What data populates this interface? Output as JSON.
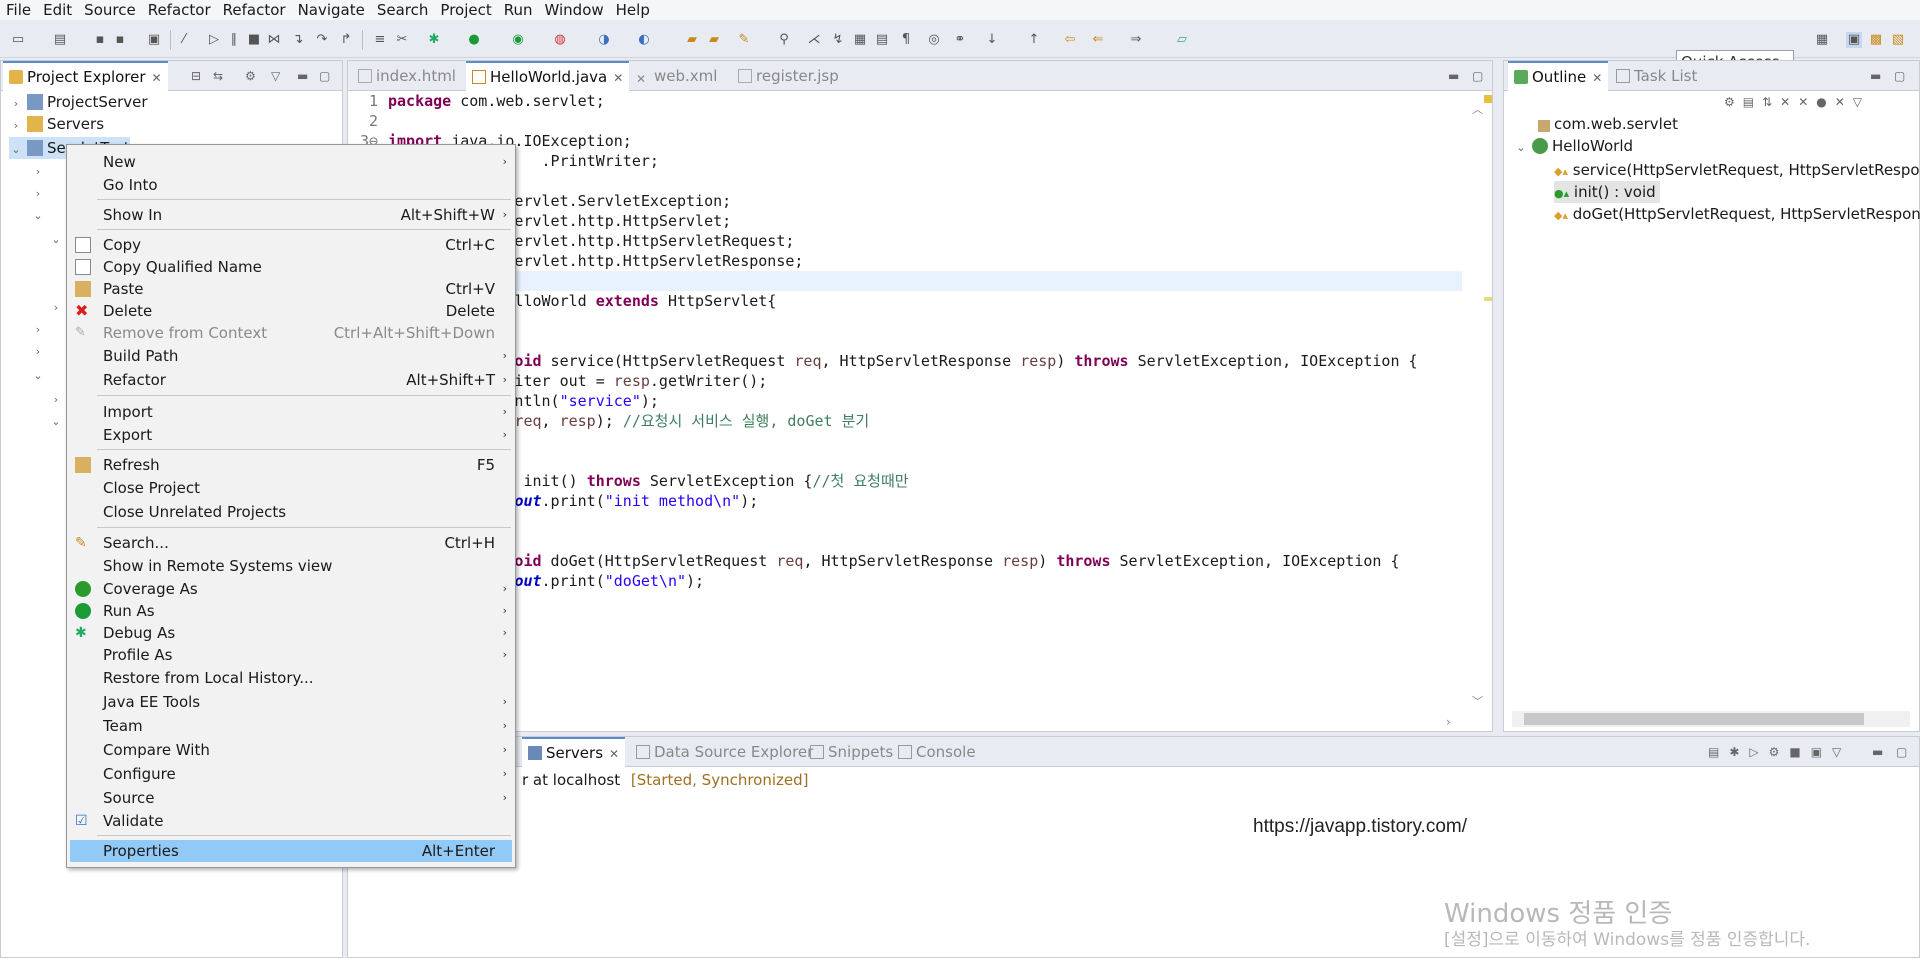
{
  "menubar": [
    "File",
    "Edit",
    "Source",
    "Refactor",
    "Refactor",
    "Navigate",
    "Search",
    "Project",
    "Run",
    "Window",
    "Help"
  ],
  "quick_access": "Quick Access",
  "project_explorer": {
    "tab_label": "Project Explorer",
    "items": [
      "ProjectServer",
      "Servers",
      "ServletTest"
    ]
  },
  "editor": {
    "tabs": [
      "index.html",
      "HelloWorld.java",
      "web.xml",
      "register.jsp"
    ],
    "active_tab": "HelloWorld.java"
  },
  "context_menu": {
    "items": [
      {
        "label": "New",
        "shortcut": "",
        "submenu": true
      },
      {
        "label": "Go Into",
        "shortcut": "",
        "submenu": false
      },
      {
        "label": "Show In",
        "shortcut": "Alt+Shift+W",
        "submenu": true
      },
      {
        "label": "Copy",
        "shortcut": "Ctrl+C",
        "submenu": false
      },
      {
        "label": "Copy Qualified Name",
        "shortcut": "",
        "submenu": false
      },
      {
        "label": "Paste",
        "shortcut": "Ctrl+V",
        "submenu": false
      },
      {
        "label": "Delete",
        "shortcut": "Delete",
        "submenu": false
      },
      {
        "label": "Remove from Context",
        "shortcut": "Ctrl+Alt+Shift+Down",
        "submenu": false
      },
      {
        "label": "Build Path",
        "shortcut": "",
        "submenu": true
      },
      {
        "label": "Refactor",
        "shortcut": "Alt+Shift+T",
        "submenu": true
      },
      {
        "label": "Import",
        "shortcut": "",
        "submenu": true
      },
      {
        "label": "Export",
        "shortcut": "",
        "submenu": true
      },
      {
        "label": "Refresh",
        "shortcut": "F5",
        "submenu": false
      },
      {
        "label": "Close Project",
        "shortcut": "",
        "submenu": false
      },
      {
        "label": "Close Unrelated Projects",
        "shortcut": "",
        "submenu": false
      },
      {
        "label": "Search...",
        "shortcut": "Ctrl+H",
        "submenu": false
      },
      {
        "label": "Show in Remote Systems view",
        "shortcut": "",
        "submenu": false
      },
      {
        "label": "Coverage As",
        "shortcut": "",
        "submenu": true
      },
      {
        "label": "Run As",
        "shortcut": "",
        "submenu": true
      },
      {
        "label": "Debug As",
        "shortcut": "",
        "submenu": true
      },
      {
        "label": "Profile As",
        "shortcut": "",
        "submenu": true
      },
      {
        "label": "Restore from Local History...",
        "shortcut": "",
        "submenu": false
      },
      {
        "label": "Java EE Tools",
        "shortcut": "",
        "submenu": true
      },
      {
        "label": "Team",
        "shortcut": "",
        "submenu": true
      },
      {
        "label": "Compare With",
        "shortcut": "",
        "submenu": true
      },
      {
        "label": "Configure",
        "shortcut": "",
        "submenu": true
      },
      {
        "label": "Source",
        "shortcut": "",
        "submenu": true
      },
      {
        "label": "Validate",
        "shortcut": "",
        "submenu": false
      },
      {
        "label": "Properties",
        "shortcut": "Alt+Enter",
        "submenu": false
      }
    ]
  },
  "outline": {
    "tabs": [
      "Outline",
      "Task List"
    ],
    "package": "com.web.servlet",
    "class": "HelloWorld",
    "members": [
      "service(HttpServletRequest, HttpServletResponse) :",
      "init() : void",
      "doGet(HttpServletRequest, HttpServletResponse) :"
    ]
  },
  "bottom_panel": {
    "tabs": [
      "Servers",
      "Data Source Explorer",
      "Snippets",
      "Console"
    ],
    "server_row_text": "r at localhost",
    "server_status": "[Started, Synchronized]"
  },
  "overlay": {
    "url": "https://javapp.tistory.com/",
    "watermark_title": "Windows 정품 인증",
    "watermark_subtitle": "[설정]으로 이동하여 Windows를 정품 인증합니다."
  }
}
